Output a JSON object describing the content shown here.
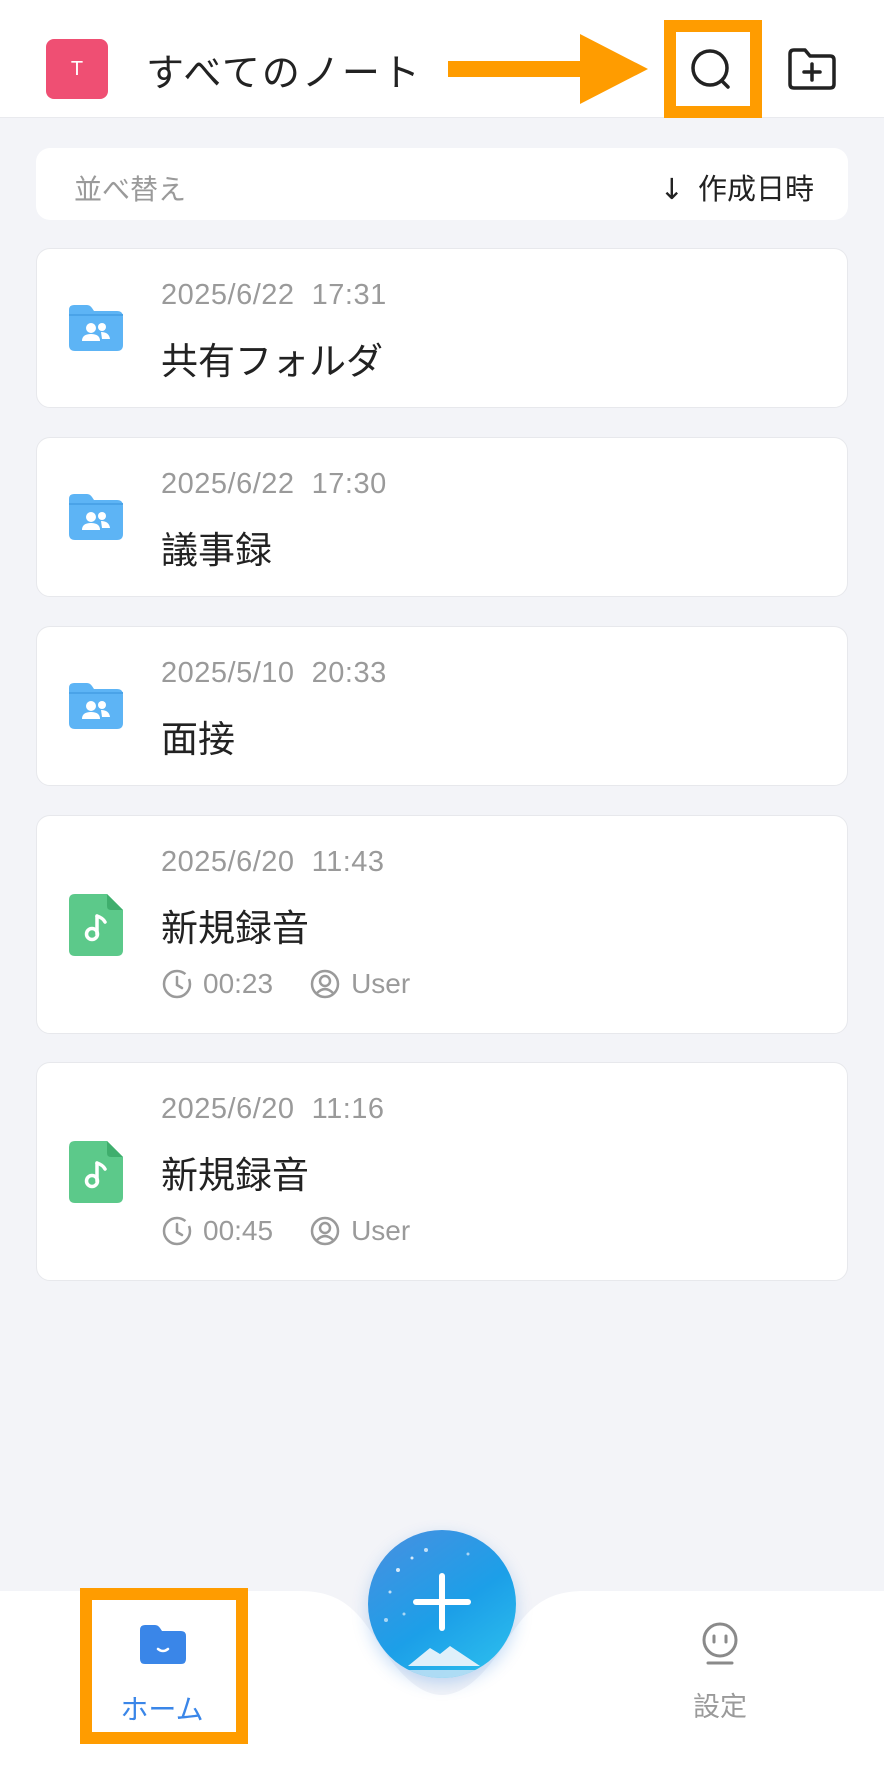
{
  "header": {
    "avatar_letter": "T",
    "title": "すべてのノート"
  },
  "sort": {
    "label": "並べ替え",
    "value": "作成日時"
  },
  "items": [
    {
      "type": "folder",
      "date": "2025/6/22  17:31",
      "title": "共有フォルダ"
    },
    {
      "type": "folder",
      "date": "2025/6/22  17:30",
      "title": "議事録"
    },
    {
      "type": "folder",
      "date": "2025/5/10  20:33",
      "title": "面接"
    },
    {
      "type": "recording",
      "date": "2025/6/20  11:43",
      "title": "新規録音",
      "duration": "00:23",
      "user": "User"
    },
    {
      "type": "recording",
      "date": "2025/6/20  11:16",
      "title": "新規録音",
      "duration": "00:45",
      "user": "User"
    }
  ],
  "nav": {
    "home_label": "ホーム",
    "settings_label": "設定"
  },
  "colors": {
    "highlight": "#ff9c00",
    "avatar": "#ef4f73",
    "folder": "#5db4f5",
    "recording": "#5cc98a",
    "accent": "#3a86e8"
  },
  "icons": [
    "search-icon",
    "new-folder-icon",
    "shared-folder-icon",
    "audio-file-icon",
    "clock-icon",
    "user-icon",
    "home-folder-icon",
    "settings-face-icon",
    "plus-icon"
  ]
}
